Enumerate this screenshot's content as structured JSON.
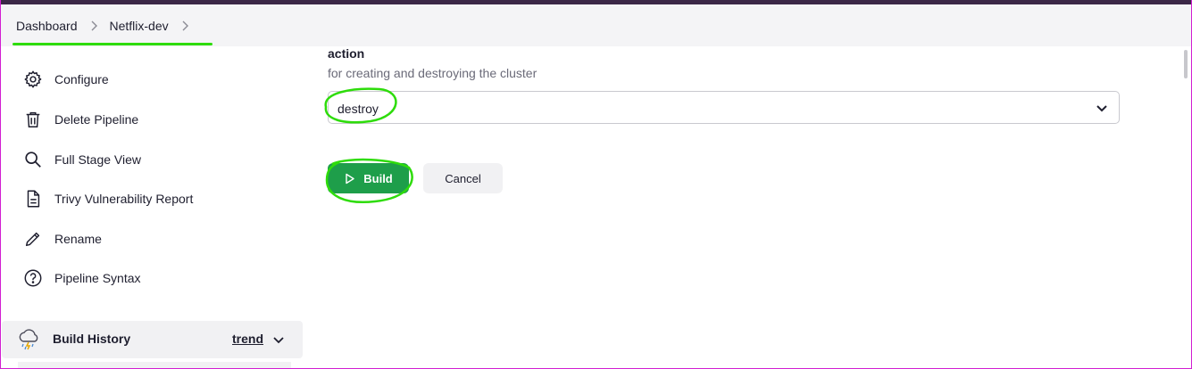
{
  "breadcrumb": {
    "items": [
      "Dashboard",
      "Netflix-dev"
    ]
  },
  "sidebar": {
    "items": [
      {
        "label": "Configure",
        "icon": "gear-icon"
      },
      {
        "label": "Delete Pipeline",
        "icon": "trash-icon"
      },
      {
        "label": "Full Stage View",
        "icon": "search-icon"
      },
      {
        "label": "Trivy Vulnerability Report",
        "icon": "document-icon"
      },
      {
        "label": "Rename",
        "icon": "pencil-icon"
      },
      {
        "label": "Pipeline Syntax",
        "icon": "help-circle-icon"
      }
    ],
    "build_history": {
      "label": "Build History",
      "trend_label": "trend",
      "icon": "weather-storm-icon"
    }
  },
  "main": {
    "parameter": {
      "name": "action",
      "description": "for creating and destroying the cluster",
      "selected_value": "destroy"
    },
    "buttons": {
      "build_label": "Build",
      "cancel_label": "Cancel"
    }
  },
  "colors": {
    "accent_green": "#1e9e4a",
    "annotation_green": "#2edc0b",
    "top_bar": "#3b2747"
  }
}
